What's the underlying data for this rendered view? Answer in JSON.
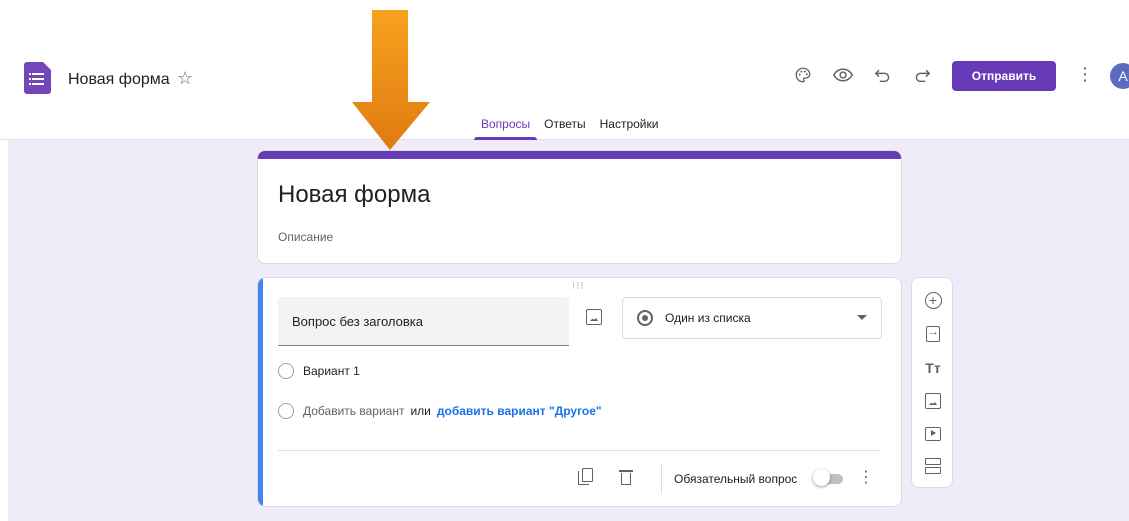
{
  "header": {
    "doc_title": "Новая форма",
    "send_label": "Отправить",
    "avatar_initial": "A",
    "icons": [
      "palette-icon",
      "eye-icon",
      "undo-icon",
      "redo-icon",
      "more-vert-icon"
    ]
  },
  "tabs": [
    {
      "label": "Вопросы",
      "active": true
    },
    {
      "label": "Ответы",
      "active": false
    },
    {
      "label": "Настройки",
      "active": false
    }
  ],
  "form": {
    "title": "Новая форма",
    "description_placeholder": "Описание"
  },
  "question": {
    "title": "Вопрос без заголовка",
    "type": "Один из списка",
    "options": [
      "Вариант 1"
    ],
    "add_option": "Добавить вариант",
    "or": "или",
    "add_other": "добавить вариант \"Другое\"",
    "required_label": "Обязательный вопрос",
    "required": false
  },
  "colors": {
    "accent": "#673ab7",
    "canvas": "#f0ebf8",
    "active_question": "#4285f4",
    "link": "#1a73e8",
    "annotation_arrow": "#f5921e"
  }
}
